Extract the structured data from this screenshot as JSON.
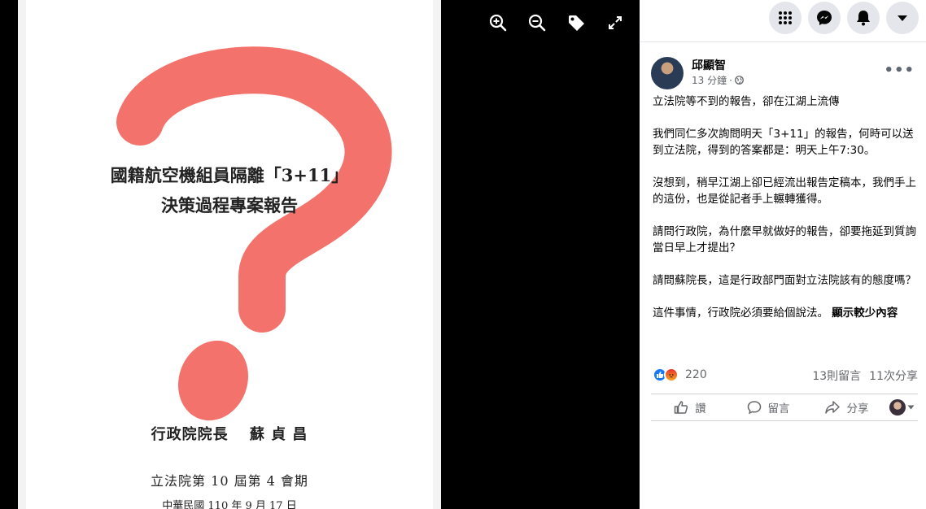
{
  "document": {
    "title_line1": "國籍航空機組員隔離「3+11」",
    "title_line2": "決策過程專案報告",
    "premier": "行政院院長　 蘇 貞 昌",
    "session": "立法院第 10 屆第 4 會期",
    "date": "中華民國 110 年 9 月 17 日"
  },
  "viewer_tools": [
    "zoom-in-icon",
    "zoom-out-icon",
    "tag-icon",
    "fullscreen-icon"
  ],
  "top_nav": [
    "menu-grid-icon",
    "messenger-icon",
    "notifications-icon",
    "account-dropdown-icon"
  ],
  "post": {
    "author": "邱顯智",
    "time": "13 分鐘",
    "separator": "·",
    "paragraphs": [
      "立法院等不到的報告，卻在江湖上流傳",
      "我們同仁多次詢問明天「3+11」的報告，何時可以送到立法院，得到的答案都是：明天上午7:30。",
      "沒想到，稍早江湖上卻已經流出報告定稿本，我們手上的這份，也是從記者手上輾轉獲得。",
      "請問行政院，為什麼早就做好的報告，卻要拖延到質詢當日早上才提出？",
      "請問蘇院長，這是行政部門面對立法院該有的態度嗎？"
    ],
    "last_paragraph": "這件事情，行政院必須要給個說法。",
    "see_less": "顯示較少內容",
    "reaction_count": "220",
    "comments": "13則留言",
    "shares": "11次分享",
    "actions": {
      "like": "讚",
      "comment": "留言",
      "share": "分享"
    }
  },
  "colors": {
    "question_mark": "#f26b64",
    "facebook_blue": "#1877f2",
    "panel_bg": "#ffffff"
  }
}
